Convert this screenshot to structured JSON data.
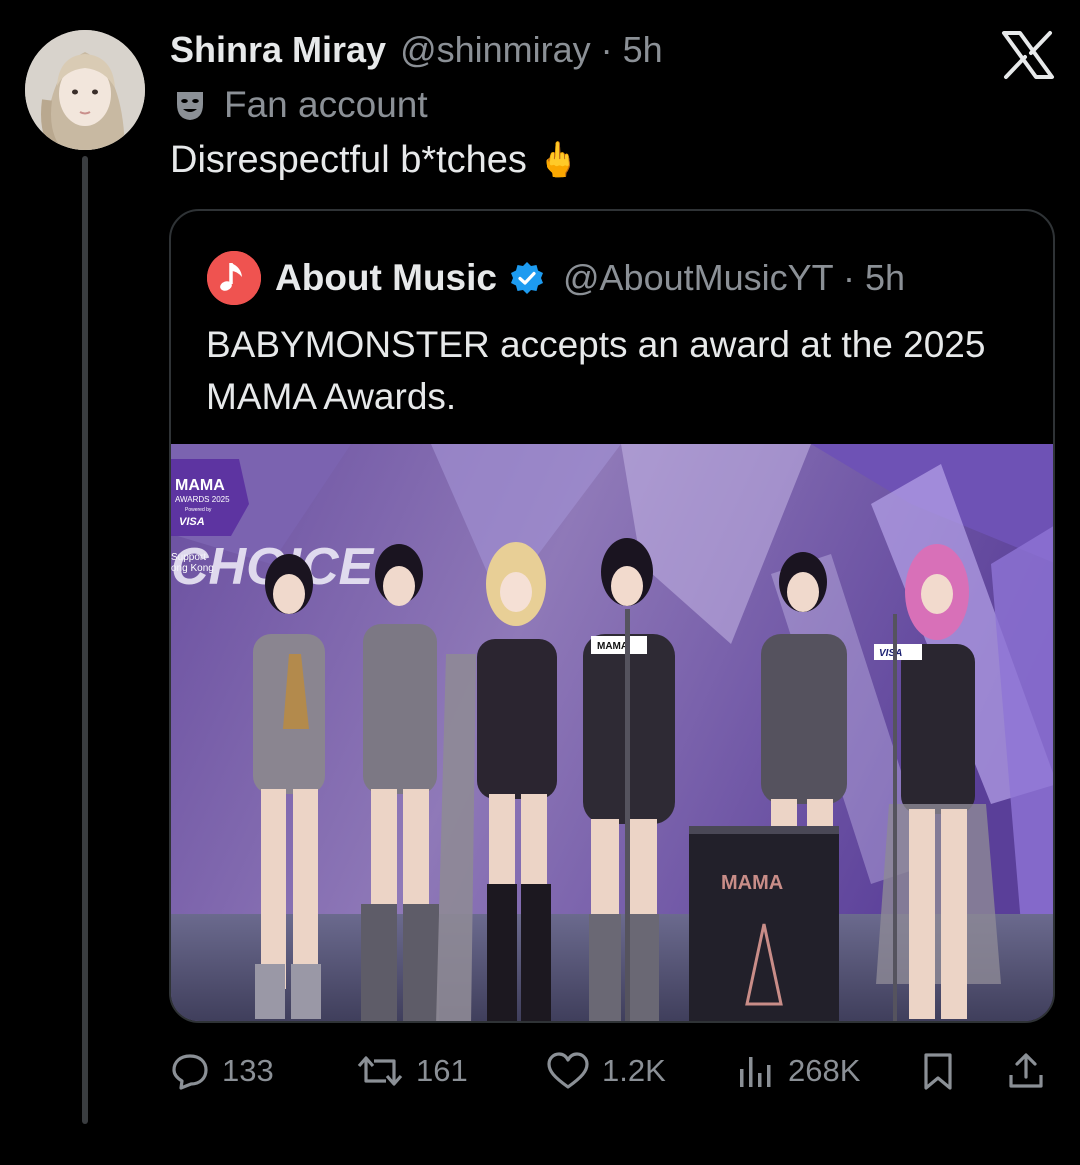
{
  "author": {
    "display_name": "Shinra Miray",
    "handle_time": "@shinmiray · 5h",
    "label": "Fan account",
    "label_icon": "theater-masks-icon",
    "avatar_icon": "avatar"
  },
  "tweet": {
    "text": "Disrespectful b*tches",
    "emoji": "🖕"
  },
  "quote": {
    "name": "About Music",
    "handle_time": "@AboutMusicYT · 5h",
    "verified_color": "#1d9bf0",
    "avatar_color": "#ef5350",
    "text": "BABYMONSTER accepts an award at the 2025 MAMA Awards.",
    "media": {
      "logo_title": "MAMA",
      "logo_sub": "AWARDS 2025",
      "logo_powered": "Powered by",
      "logo_sponsor": "VISA",
      "support_line1": "Support",
      "support_line2": "ong Kong",
      "backdrop_text": "CHOICE",
      "mic_label": "MAMA",
      "stand_label": "VISA",
      "podium_label": "MAMA"
    }
  },
  "actions": {
    "replies": "133",
    "reposts": "161",
    "likes": "1.2K",
    "views": "268K"
  },
  "colors": {
    "background": "#000000",
    "primary_text": "#e7e9ea",
    "secondary_text": "#8b9096",
    "border": "#2f3336"
  }
}
